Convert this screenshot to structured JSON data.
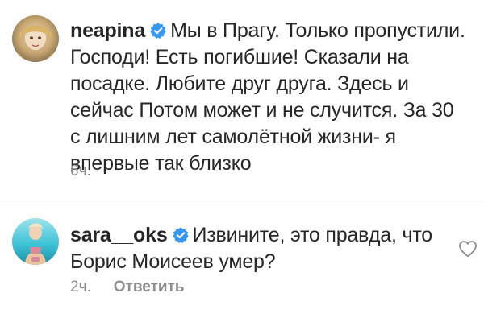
{
  "comments": [
    {
      "username": "neapina",
      "verified": true,
      "text": "Мы в Прагу. Только пропустили. Господи! Есть погибшие! Сказали на посадке. Любите друг друга. Здесь и сейчас Потом может и не случится. За 30 с лишним лет самолётной жизни- я впервые так близко",
      "time": "6ч."
    },
    {
      "username": "sara__oks",
      "verified": true,
      "text": "Извините, это правда, что Борис Моисеев умер?",
      "time": "2ч.",
      "reply_label": "Ответить",
      "like_icon": "heart-outline-icon"
    }
  ],
  "colors": {
    "text": "#262626",
    "secondary": "#8e8e8e",
    "verified_badge": "#3897f0",
    "divider": "#dbdbdb"
  }
}
